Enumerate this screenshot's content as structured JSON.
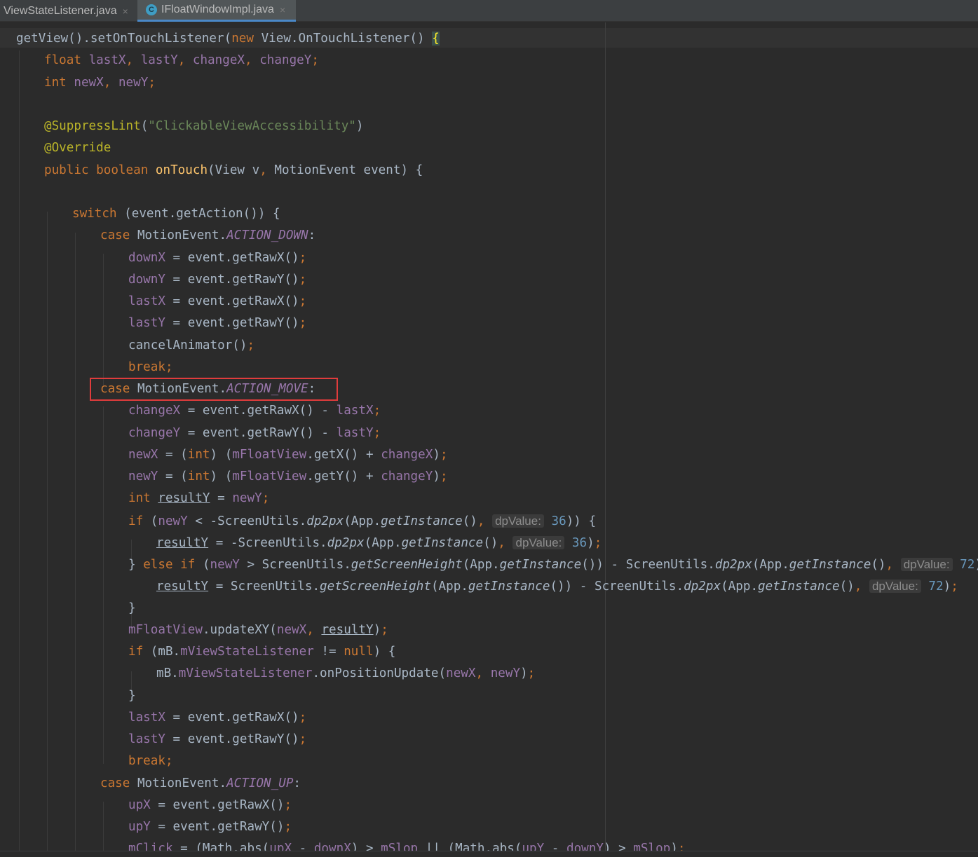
{
  "tabs": [
    {
      "label": "ViewStateListener.java",
      "active": false,
      "icon": "none"
    },
    {
      "label": "IFloatWindowImpl.java",
      "active": true,
      "icon": "java-class-icon"
    }
  ],
  "tab_close_glyph": "×",
  "class_icon_letter": "C",
  "highlight": {
    "color": "#e03c3c",
    "line": "case MotionEvent.ACTION_MOVE:"
  },
  "code_lines": [
    [
      [
        "",
        "getView().setOnTouchListener("
      ],
      [
        "kw",
        "new "
      ],
      [
        "",
        "View.OnTouchListener() "
      ],
      [
        "bracemark",
        "{"
      ]
    ],
    [
      [
        "kw",
        "float "
      ],
      [
        "fld",
        "lastX"
      ],
      [
        "kw",
        ", "
      ],
      [
        "fld",
        "lastY"
      ],
      [
        "kw",
        ", "
      ],
      [
        "fld",
        "changeX"
      ],
      [
        "kw",
        ", "
      ],
      [
        "fld",
        "changeY"
      ],
      [
        "kw",
        ";"
      ]
    ],
    [
      [
        "kw",
        "int "
      ],
      [
        "fld",
        "newX"
      ],
      [
        "kw",
        ", "
      ],
      [
        "fld",
        "newY"
      ],
      [
        "kw",
        ";"
      ]
    ],
    [],
    [
      [
        "ann",
        "@SuppressLint"
      ],
      [
        "",
        "("
      ],
      [
        "str",
        "\"ClickableViewAccessibility\""
      ],
      [
        "",
        ")"
      ]
    ],
    [
      [
        "ann",
        "@Override"
      ]
    ],
    [
      [
        "kw",
        "public boolean "
      ],
      [
        "fn",
        "onTouch"
      ],
      [
        "",
        "(View v"
      ],
      [
        "kw",
        ", "
      ],
      [
        "",
        "MotionEvent event) {"
      ]
    ],
    [],
    [
      [
        "kw",
        "switch "
      ],
      [
        "",
        "(event.getAction()) {"
      ]
    ],
    [
      [
        "kw",
        "case "
      ],
      [
        "",
        "MotionEvent."
      ],
      [
        "cnst",
        "ACTION_DOWN"
      ],
      [
        "",
        ":"
      ]
    ],
    [
      [
        "fld",
        "downX"
      ],
      [
        "",
        " = event.getRawX()"
      ],
      [
        "kw",
        ";"
      ]
    ],
    [
      [
        "fld",
        "downY"
      ],
      [
        "",
        " = event.getRawY()"
      ],
      [
        "kw",
        ";"
      ]
    ],
    [
      [
        "fld",
        "lastX"
      ],
      [
        "",
        " = event.getRawX()"
      ],
      [
        "kw",
        ";"
      ]
    ],
    [
      [
        "fld",
        "lastY"
      ],
      [
        "",
        " = event.getRawY()"
      ],
      [
        "kw",
        ";"
      ]
    ],
    [
      [
        "",
        "cancelAnimator()"
      ],
      [
        "kw",
        ";"
      ]
    ],
    [
      [
        "kw",
        "break;"
      ]
    ],
    [
      [
        "kw",
        "case "
      ],
      [
        "",
        "MotionEvent."
      ],
      [
        "cnst",
        "ACTION_MOVE"
      ],
      [
        "",
        ":"
      ]
    ],
    [
      [
        "fld",
        "changeX"
      ],
      [
        "",
        " = event.getRawX() - "
      ],
      [
        "fld",
        "lastX"
      ],
      [
        "kw",
        ";"
      ]
    ],
    [
      [
        "fld",
        "changeY"
      ],
      [
        "",
        " = event.getRawY() - "
      ],
      [
        "fld",
        "lastY"
      ],
      [
        "kw",
        ";"
      ]
    ],
    [
      [
        "fld",
        "newX"
      ],
      [
        "",
        " = ("
      ],
      [
        "kw",
        "int"
      ],
      [
        "",
        ") ("
      ],
      [
        "fld",
        "mFloatView"
      ],
      [
        "",
        ".getX() + "
      ],
      [
        "fld",
        "changeX"
      ],
      [
        "",
        ")"
      ],
      [
        "kw",
        ";"
      ]
    ],
    [
      [
        "fld",
        "newY"
      ],
      [
        "",
        " = ("
      ],
      [
        "kw",
        "int"
      ],
      [
        "",
        ") ("
      ],
      [
        "fld",
        "mFloatView"
      ],
      [
        "",
        ".getY() + "
      ],
      [
        "fld",
        "changeY"
      ],
      [
        "",
        ")"
      ],
      [
        "kw",
        ";"
      ]
    ],
    [
      [
        "kw",
        "int "
      ],
      [
        "u",
        "resultY"
      ],
      [
        "",
        " = "
      ],
      [
        "fld",
        "newY"
      ],
      [
        "kw",
        ";"
      ]
    ],
    [
      [
        "kw",
        "if "
      ],
      [
        "",
        "("
      ],
      [
        "fld",
        "newY"
      ],
      [
        "",
        " < -ScreenUtils."
      ],
      [
        "ital",
        "dp2px"
      ],
      [
        "",
        "(App."
      ],
      [
        "ital",
        "getInstance"
      ],
      [
        "",
        "()"
      ],
      [
        "kw",
        ", "
      ],
      [
        "hint",
        "dpValue:"
      ],
      [
        "num",
        " 36"
      ],
      [
        "",
        ")) {"
      ]
    ],
    [
      [
        "u",
        "resultY"
      ],
      [
        "",
        " = -ScreenUtils."
      ],
      [
        "ital",
        "dp2px"
      ],
      [
        "",
        "(App."
      ],
      [
        "ital",
        "getInstance"
      ],
      [
        "",
        "()"
      ],
      [
        "kw",
        ", "
      ],
      [
        "hint",
        "dpValue:"
      ],
      [
        "num",
        " 36"
      ],
      [
        "",
        ")"
      ],
      [
        "kw",
        ";"
      ]
    ],
    [
      [
        "",
        "} "
      ],
      [
        "kw",
        "else if "
      ],
      [
        "",
        "("
      ],
      [
        "fld",
        "newY"
      ],
      [
        "",
        " > ScreenUtils."
      ],
      [
        "ital",
        "getScreenHeight"
      ],
      [
        "",
        "(App."
      ],
      [
        "ital",
        "getInstance"
      ],
      [
        "",
        "()) - ScreenUtils."
      ],
      [
        "ital",
        "dp2px"
      ],
      [
        "",
        "(App."
      ],
      [
        "ital",
        "getInstance"
      ],
      [
        "",
        "()"
      ],
      [
        "kw",
        ", "
      ],
      [
        "hint",
        "dpValue:"
      ],
      [
        "num",
        " 72"
      ],
      [
        "",
        ")) {"
      ]
    ],
    [
      [
        "u",
        "resultY"
      ],
      [
        "",
        " = ScreenUtils."
      ],
      [
        "ital",
        "getScreenHeight"
      ],
      [
        "",
        "(App."
      ],
      [
        "ital",
        "getInstance"
      ],
      [
        "",
        "()) - ScreenUtils."
      ],
      [
        "ital",
        "dp2px"
      ],
      [
        "",
        "(App."
      ],
      [
        "ital",
        "getInstance"
      ],
      [
        "",
        "()"
      ],
      [
        "kw",
        ", "
      ],
      [
        "hint",
        "dpValue:"
      ],
      [
        "num",
        " 72"
      ],
      [
        "",
        ")"
      ],
      [
        "kw",
        ";"
      ]
    ],
    [
      [
        "",
        "}"
      ]
    ],
    [
      [
        "fld",
        "mFloatView"
      ],
      [
        "",
        ".updateXY("
      ],
      [
        "fld",
        "newX"
      ],
      [
        "kw",
        ", "
      ],
      [
        "u",
        "resultY"
      ],
      [
        "",
        ")"
      ],
      [
        "kw",
        ";"
      ]
    ],
    [
      [
        "kw",
        "if "
      ],
      [
        "",
        "(mB."
      ],
      [
        "fld",
        "mViewStateListener"
      ],
      [
        "",
        " != "
      ],
      [
        "kw",
        "null"
      ],
      [
        "",
        ") {"
      ]
    ],
    [
      [
        "",
        "mB."
      ],
      [
        "fld",
        "mViewStateListener"
      ],
      [
        "",
        ".onPositionUpdate("
      ],
      [
        "fld",
        "newX"
      ],
      [
        "kw",
        ", "
      ],
      [
        "fld",
        "newY"
      ],
      [
        "",
        ")"
      ],
      [
        "kw",
        ";"
      ]
    ],
    [
      [
        "",
        "}"
      ]
    ],
    [
      [
        "fld",
        "lastX"
      ],
      [
        "",
        " = event.getRawX()"
      ],
      [
        "kw",
        ";"
      ]
    ],
    [
      [
        "fld",
        "lastY"
      ],
      [
        "",
        " = event.getRawY()"
      ],
      [
        "kw",
        ";"
      ]
    ],
    [
      [
        "kw",
        "break;"
      ]
    ],
    [
      [
        "kw",
        "case "
      ],
      [
        "",
        "MotionEvent."
      ],
      [
        "cnst",
        "ACTION_UP"
      ],
      [
        "",
        ":"
      ]
    ],
    [
      [
        "fld",
        "upX"
      ],
      [
        "",
        " = event.getRawX()"
      ],
      [
        "kw",
        ";"
      ]
    ],
    [
      [
        "fld",
        "upY"
      ],
      [
        "",
        " = event.getRawY()"
      ],
      [
        "kw",
        ";"
      ]
    ],
    [
      [
        "fld",
        "mClick"
      ],
      [
        "",
        " = (Math.abs("
      ],
      [
        "fld",
        "upX"
      ],
      [
        "",
        " - "
      ],
      [
        "fld",
        "downX"
      ],
      [
        "",
        ") > "
      ],
      [
        "fld",
        "mSlop"
      ],
      [
        "",
        " || (Math.abs("
      ],
      [
        "fld",
        "upY"
      ],
      [
        "",
        " - "
      ],
      [
        "fld",
        "downY"
      ],
      [
        "",
        ") > "
      ],
      [
        "fld",
        "mSlop"
      ],
      [
        "",
        ")"
      ],
      [
        "kw",
        ";"
      ]
    ]
  ]
}
